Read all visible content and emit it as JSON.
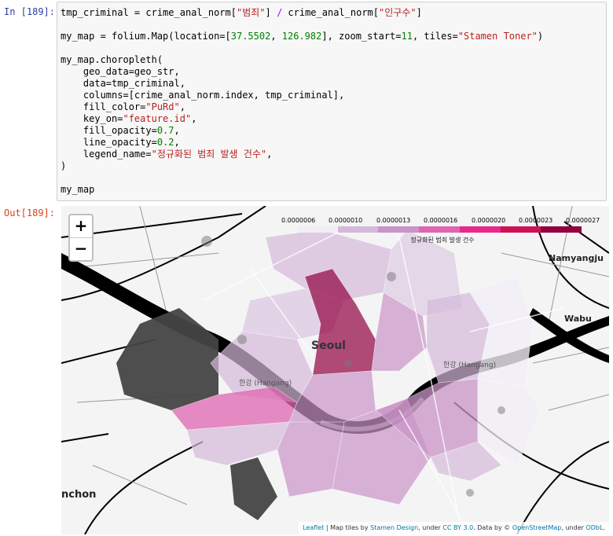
{
  "cell": {
    "in_prompt": "In [189]:",
    "out_prompt": "Out[189]:",
    "code": {
      "l1a": "tmp_criminal = crime_anal_norm[",
      "l1s1": "\"범죄\"",
      "l1b": "] ",
      "l1op": "/",
      "l1c": " crime_anal_norm[",
      "l1s2": "\"인구수\"",
      "l1d": "]",
      "l3a": "my_map = folium.Map(location=[",
      "l3n1": "37.5502",
      "l3b": ", ",
      "l3n2": "126.982",
      "l3c": "], zoom_start=",
      "l3n3": "11",
      "l3d": ", tiles=",
      "l3s": "\"Stamen Toner\"",
      "l3e": ")",
      "l5": "my_map.choropleth(",
      "l6": "    geo_data=geo_str,",
      "l7": "    data=tmp_criminal,",
      "l8": "    columns=[crime_anal_norm.index, tmp_criminal],",
      "l9a": "    fill_color=",
      "l9s": "\"PuRd\"",
      "l9b": ",",
      "l10a": "    key_on=",
      "l10s": "\"feature.id\"",
      "l10b": ",",
      "l11a": "    fill_opacity=",
      "l11n": "0.7",
      "l11b": ",",
      "l12a": "    line_opacity=",
      "l12n": "0.2",
      "l12b": ",",
      "l13a": "    legend_name=",
      "l13s": "\"정규화된 범죄 발생 건수\"",
      "l13b": ",",
      "l14": ")",
      "l16": "my_map"
    }
  },
  "map": {
    "zoom_in": "+",
    "zoom_out": "−",
    "legend": {
      "ticks": [
        "0.0000006",
        "0.0000010",
        "0.0000013",
        "0.0000016",
        "0.0000020",
        "0.0000023",
        "0.0000027"
      ],
      "colors": [
        "#f1eef6",
        "#d4b9da",
        "#c994c7",
        "#df65b0",
        "#e7298a",
        "#ce1256",
        "#91003f"
      ],
      "title": "정규화된 범죄 발생 건수"
    },
    "labels": {
      "seoul": "Seoul",
      "hangang_left": "한강 (Hangang)",
      "hangang_right": "한강 (Hangang)",
      "namyangju": "Namyangju",
      "wabu": "Wabu",
      "incheon": "nchon"
    },
    "attribution": {
      "leaflet": "Leaflet",
      "t1": " | Map tiles by ",
      "stamen": "Stamen Design",
      "t2": ", under ",
      "ccby": "CC BY 3.0",
      "t3": ". Data by © ",
      "osm": "OpenStreetMap",
      "t4": ", under ",
      "odbl": "ODbL",
      "t5": "."
    }
  }
}
